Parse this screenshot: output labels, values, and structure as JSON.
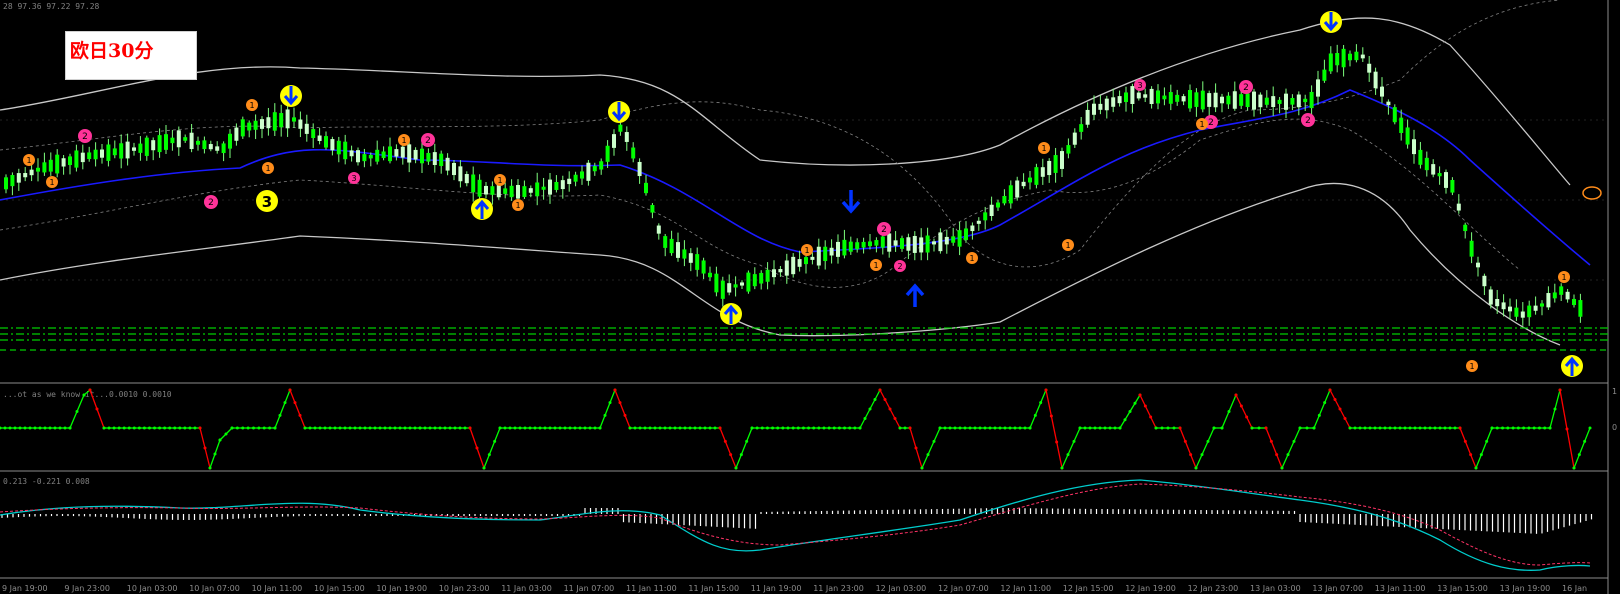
{
  "window": {
    "title": "欧日30分"
  },
  "main_panel": {
    "header": "28 97.36 97.22 97.28"
  },
  "indicator_panel_1": {
    "header": "...ot as we know it...0.0010 0.0010",
    "level_labels": [
      "1",
      "0"
    ]
  },
  "indicator_panel_2": {
    "header": "0.213 -0.221 0.008"
  },
  "time_axis": {
    "labels": [
      "9 Jan 19:00",
      "9 Jan 23:00",
      "10 Jan 03:00",
      "10 Jan 07:00",
      "10 Jan 11:00",
      "10 Jan 15:00",
      "10 Jan 19:00",
      "10 Jan 23:00",
      "11 Jan 03:00",
      "11 Jan 07:00",
      "11 Jan 11:00",
      "11 Jan 15:00",
      "11 Jan 19:00",
      "11 Jan 23:00",
      "12 Jan 03:00",
      "12 Jan 07:00",
      "12 Jan 11:00",
      "12 Jan 15:00",
      "12 Jan 19:00",
      "12 Jan 23:00",
      "13 Jan 03:00",
      "13 Jan 07:00",
      "13 Jan 11:00",
      "13 Jan 15:00",
      "13 Jan 19:00",
      "16 Jan"
    ]
  },
  "markers": {
    "wave_labels": [
      "1",
      "2",
      "1",
      "1",
      "2",
      "3",
      "1",
      "2",
      "1",
      "2",
      "1",
      "2",
      "1",
      "2",
      "1",
      "2"
    ],
    "big_label": "3"
  },
  "colors": {
    "background": "#000000",
    "bull_candle": "#ccffcc",
    "bear_candle": "#00ff00",
    "ma_line": "#1a1aff",
    "band_line": "#c8c8c8",
    "inner_band": "#808080",
    "level_line": "#00cc00",
    "step_up": "#00ff00",
    "step_down": "#ff0000",
    "macd_signal": "#00cccc",
    "macd_dash": "#ff3366",
    "arrow_blue": "#0033ff",
    "arrow_circle": "#ffff00",
    "label_orange": "#ff8c1a",
    "label_magenta": "#ff3399"
  }
}
